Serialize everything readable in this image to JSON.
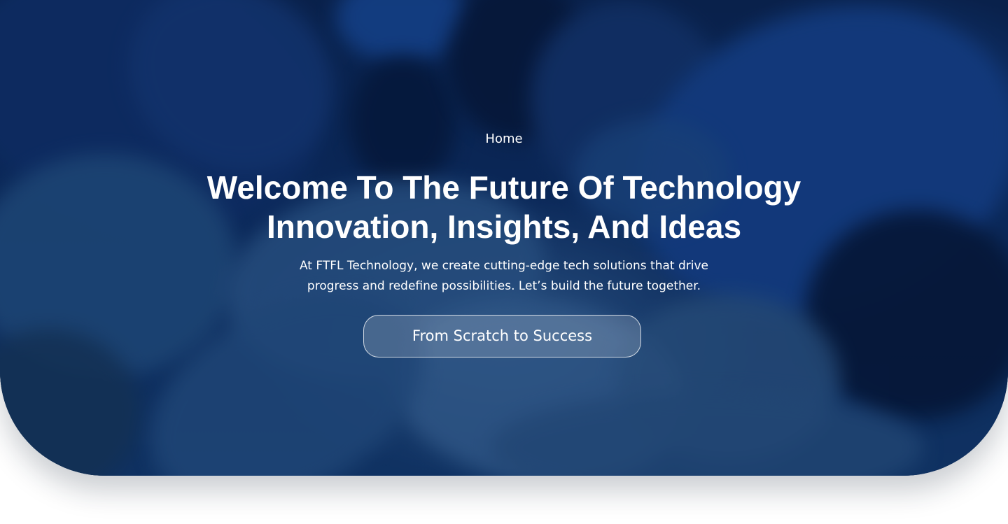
{
  "hero": {
    "breadcrumb": "Home",
    "title_line1": "Welcome To The Future Of Technology",
    "title_line2": "Innovation, Insights, And Ideas",
    "subtitle_line1": "At FTFL Technology, we create cutting-edge tech solutions that drive",
    "subtitle_line2": "progress and redefine possibilities. Let’s build the future together.",
    "cta_label": "From Scratch to Success"
  },
  "colors": {
    "overlay": "#0a2a6b",
    "text": "#ffffff",
    "page_background": "#ffffff"
  }
}
